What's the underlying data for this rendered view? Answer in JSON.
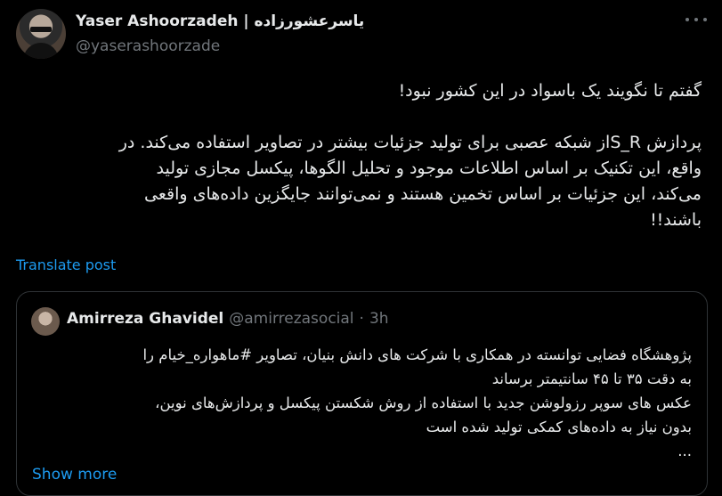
{
  "author": {
    "display_name": "Yaser Ashoorzadeh | یاسرعشورزاده",
    "handle": "@yaserashoorzade"
  },
  "tweet": {
    "lines": [
      "گفتم تا نگویند یک باسواد در این کشور نبود!",
      "",
      "پردازش S_Rاز شبکه عصبی برای تولید جزئیات بیشتر در تصاویر استفاده می‌کند. در",
      "واقع، این تکنیک بر اساس اطلاعات موجود و تحلیل الگوها، پیکسل مجازی تولید",
      "می‌کند،  این جزئیات بر اساس تخمین هستند و نمی‌توانند جایگزین داده‌های واقعی",
      "باشند!!"
    ]
  },
  "translate_label": "Translate post",
  "quote": {
    "display_name": "Amirreza Ghavidel",
    "handle": "@amirrezasocial",
    "separator": "·",
    "time": "3h",
    "lines": [
      "پژوهشگاه فضایی توانسته در همکاری با شرکت های دانش بنیان، تصاویر #ماهواره_خیام را",
      "به دقت ۳۵ تا ۴۵ سانتیمتر برساند",
      "عکس های سوپر رزولوشن جدید با استفاده از روش شکستن پیکسل و پردازش‌های نوین،",
      "بدون نیاز به داده‌های کمکی تولید شده است",
      "..."
    ],
    "show_more_label": "Show more"
  },
  "icons": {
    "more": "more-horizontal-icon"
  },
  "colors": {
    "background": "#000000",
    "text": "#e7e9ea",
    "muted": "#71767b",
    "link": "#1d9bf0",
    "border": "#2f3336"
  }
}
